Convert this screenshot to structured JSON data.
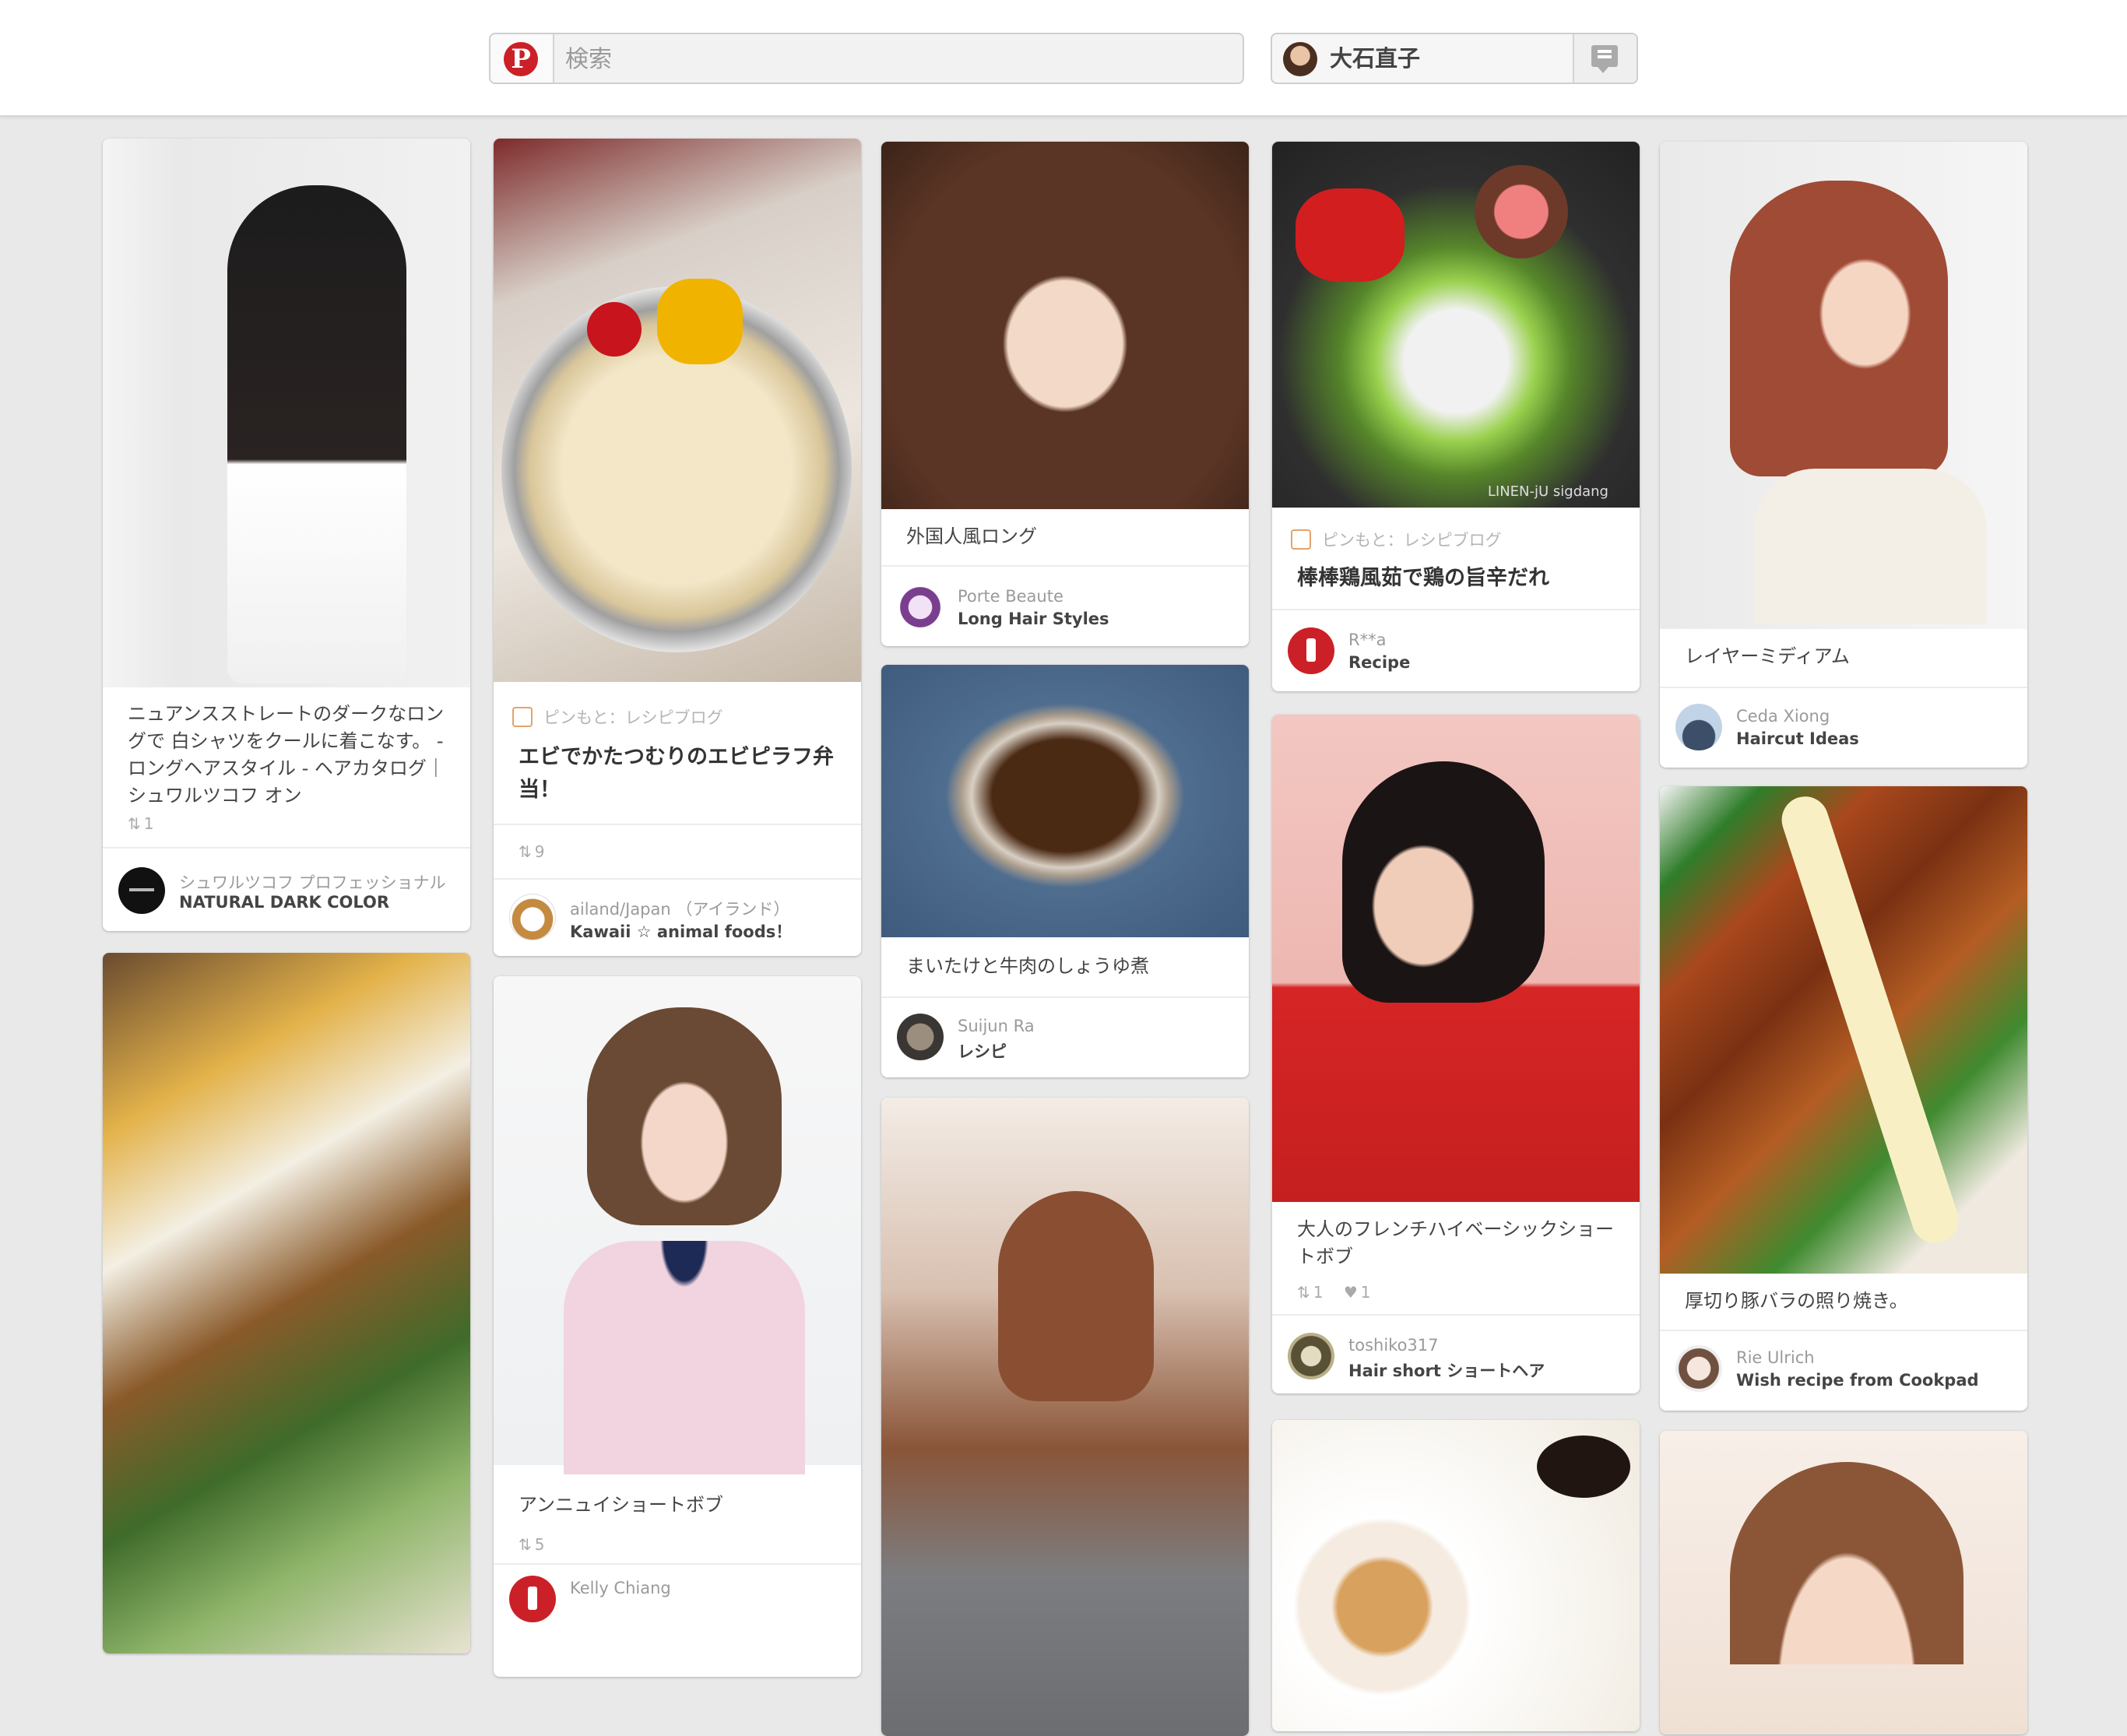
{
  "header": {
    "search_placeholder": "検索",
    "user_name": "大石直子",
    "brand_color": "#cb2027",
    "logo_icon": "pinterest-logo-icon",
    "notify_icon": "notification-icon"
  },
  "pins": [
    {
      "desc": "ニュアンスストレートのダークなロングで 白シャツをクールに着こなす。 - ロングヘアスタイル - ヘアカタログ｜シュワルツコフ オン",
      "stats_repins": "1",
      "user": "シュワルツコフ プロフェッショナル",
      "board": "NATURAL DARK COLOR"
    },
    {
      "source": "ピンもと：レシピブログ",
      "desc": "エビでかたつむりのエビピラフ弁当！",
      "stats_repins": "9",
      "user": "ailand/Japan （アイランド）",
      "board": "Kawaii ☆ animal foods！"
    },
    {
      "desc": "外国人風ロング",
      "user": "Porte Beaute",
      "board": "Long Hair Styles"
    },
    {
      "source": "ピンもと：レシピブログ",
      "desc": "棒棒鶏風茹で鶏の旨辛だれ",
      "user": "R**a",
      "board": "Recipe",
      "watermark": "LINEN-jU sigdang"
    },
    {
      "desc": "レイヤーミディアム",
      "user": "Ceda Xiong",
      "board": "Haircut Ideas"
    },
    {
      "desc": "まいたけと牛肉のしょうゆ煮",
      "user": "Suijun Ra",
      "board": "レシピ"
    },
    {
      "desc": "大人のフレンチハイベーシックショートボブ",
      "stats_repins": "1",
      "stats_likes": "1",
      "user": "toshiko317",
      "board": "Hair short ショートヘア"
    },
    {
      "desc": "アンニュイショートボブ",
      "stats_repins": "5",
      "user": "Kelly Chiang"
    },
    {
      "desc": "厚切り豚バラの照り焼き。",
      "user": "Rie Ulrich",
      "board": "Wish recipe from Cookpad"
    }
  ],
  "icons": {
    "repin": "repin-icon",
    "like": "heart-icon"
  }
}
